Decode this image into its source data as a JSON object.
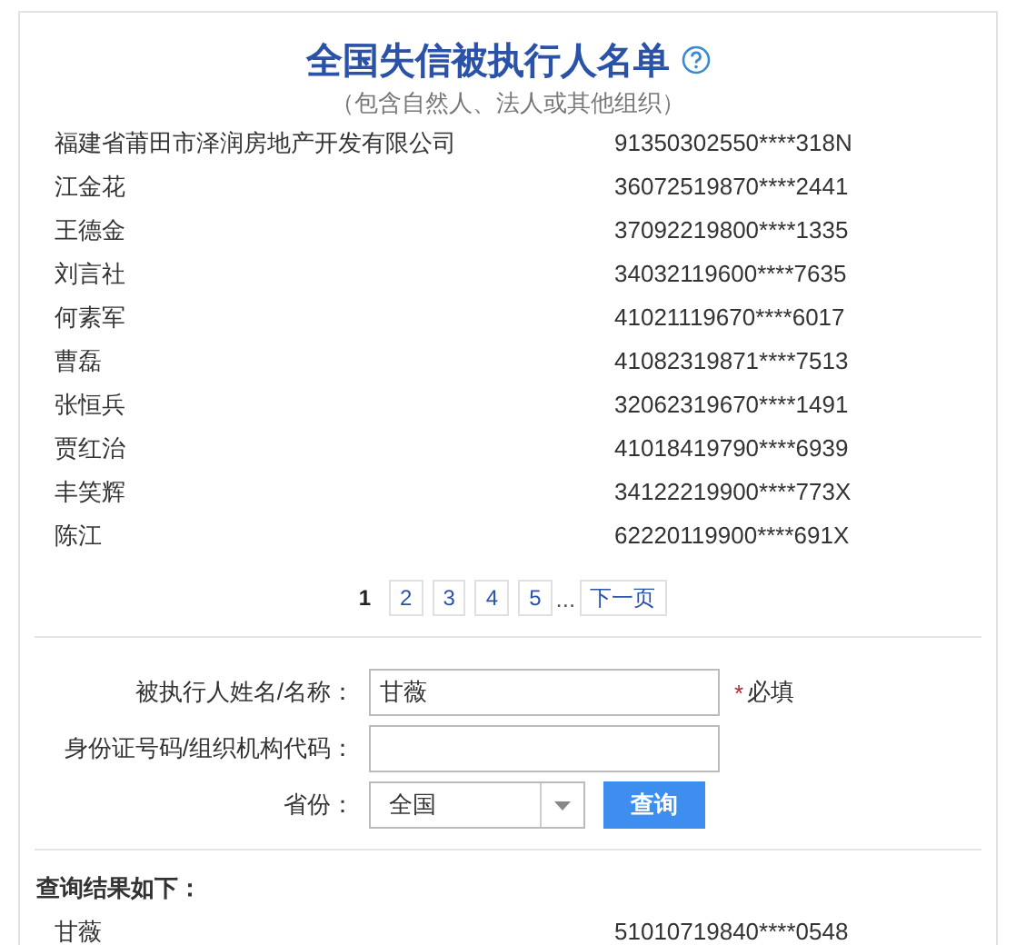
{
  "title": "全国失信被执行人名单",
  "subtitle": "（包含自然人、法人或其他组织）",
  "list": [
    {
      "name": "福建省莆田市泽润房地产开发有限公司",
      "code": "91350302550****318N"
    },
    {
      "name": "江金花",
      "code": "36072519870****2441"
    },
    {
      "name": "王德金",
      "code": "37092219800****1335"
    },
    {
      "name": "刘言社",
      "code": "34032119600****7635"
    },
    {
      "name": "何素军",
      "code": "41021119670****6017"
    },
    {
      "name": "曹磊",
      "code": "41082319871****7513"
    },
    {
      "name": "张恒兵",
      "code": "32062319670****1491"
    },
    {
      "name": "贾红治",
      "code": "41018419790****6939"
    },
    {
      "name": "丰笑辉",
      "code": "34122219900****773X"
    },
    {
      "name": "陈江",
      "code": "62220119900****691X"
    }
  ],
  "pagination": {
    "pages": [
      {
        "label": "1",
        "selected": true
      },
      {
        "label": "2",
        "selected": false
      },
      {
        "label": "3",
        "selected": false
      },
      {
        "label": "4",
        "selected": false
      },
      {
        "label": "5",
        "selected": false
      }
    ],
    "ellipsis": "...",
    "next": "下一页"
  },
  "form": {
    "name_label": "被执行人姓名/名称：",
    "name_value": "甘薇",
    "required_mark": "*",
    "required_text": "必填",
    "id_label": "身份证号码/组织机构代码：",
    "province_label": "省份：",
    "province_value": "全国",
    "submit": "查询"
  },
  "results": {
    "heading": "查询结果如下：",
    "rows": [
      {
        "name": "甘薇",
        "code": "51010719840****0548"
      }
    ]
  }
}
